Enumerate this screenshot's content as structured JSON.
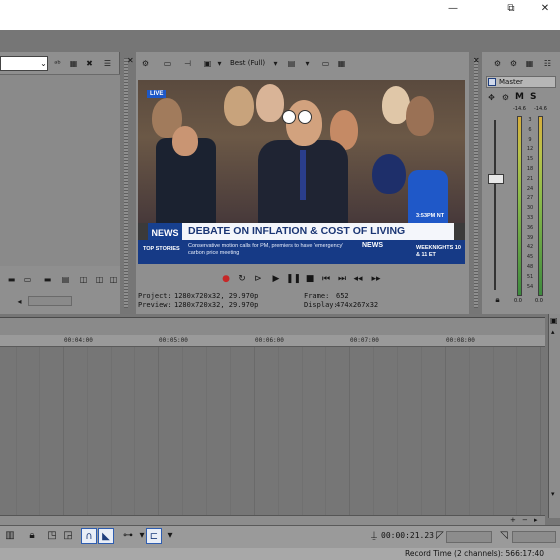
{
  "window": {
    "minimize": "—",
    "maximize": "⧉",
    "close": "✕"
  },
  "explorer": {
    "path_value": ""
  },
  "preview": {
    "toolbar": {
      "quality": "Best (Full)"
    },
    "video": {
      "live_badge": "LIVE",
      "headline": "DEBATE ON INFLATION & COST OF LIVING",
      "news_logo": "NEWS",
      "ticker_label": "TOP STORIES",
      "ticker_text": "Conservative motion calls for PM, premiers to have 'emergency' carbon price meeting",
      "ticker_logo": "NEWS",
      "ticker_show": "WEEKNIGHTS 10 & 11 ET",
      "video_time": "3:53PM NT"
    },
    "info": {
      "project_label": "Project:",
      "project_value": "1280x720x32, 29.970p",
      "preview_label": "Preview:",
      "preview_value": "1280x720x32, 29.970p",
      "frame_label": "Frame:",
      "frame_value": "652",
      "display_label": "Display:",
      "display_value": "474x267x32"
    }
  },
  "master": {
    "title": "Master",
    "m_label": "M",
    "s_label": "S",
    "peak_left": "-14.6",
    "peak_right": "-14.6",
    "floor_left": "0.0",
    "floor_right": "0.0",
    "scale": [
      "3",
      "6",
      "9",
      "12",
      "15",
      "18",
      "21",
      "24",
      "27",
      "30",
      "33",
      "36",
      "39",
      "42",
      "45",
      "48",
      "51",
      "54"
    ]
  },
  "timeline": {
    "ticks": [
      "00:04:00",
      "00:05:00",
      "00:06:00",
      "00:07:00",
      "00:08:00"
    ]
  },
  "bottom": {
    "time_readout": "00:00:21.23",
    "record_time": "Record Time (2 channels): 566:17:40"
  },
  "colors": {
    "workspace": "#767676",
    "panel": "#8f8f8f",
    "news_blue": "#163a86",
    "headline_text": "#1b3674"
  }
}
